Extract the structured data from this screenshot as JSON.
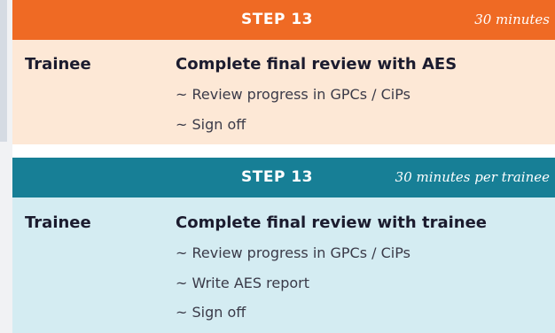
{
  "panels": [
    {
      "step": "STEP 13",
      "time": "30 minutes",
      "role": "Trainee",
      "title": "Complete final review with AES",
      "items": [
        "~ Review progress in GPCs / CiPs",
        "~ Sign off"
      ],
      "header_color": "#ef6a24",
      "body_color": "#fde8d6"
    },
    {
      "step": "STEP 13",
      "time": "30 minutes per trainee",
      "role": "Trainee",
      "title": "Complete final review with trainee",
      "items": [
        "~ Review progress in GPCs / CiPs",
        "~ Write AES report",
        "~ Sign off"
      ],
      "header_color": "#177f96",
      "body_color": "#d4ecf2"
    }
  ]
}
